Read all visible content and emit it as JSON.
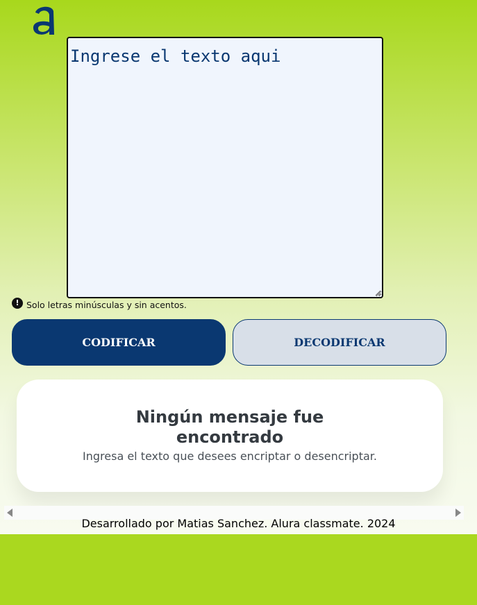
{
  "logo": {
    "icon": "alura-a-logo-icon",
    "color": "#0a3871"
  },
  "input": {
    "placeholder": "Ingrese el texto aqui",
    "value": ""
  },
  "hint": {
    "icon": "exclamation-circle-icon",
    "text": "Solo letras minúsculas y sin acentos."
  },
  "buttons": {
    "encode_label": "CODIFICAR",
    "decode_label": "DECODIFICAR"
  },
  "result": {
    "title_line1": "Ningún mensaje fue",
    "title_line2": "encontrado",
    "subtitle": "Ingresa el texto que desees encriptar o desencriptar."
  },
  "footer": {
    "text": "Desarrollado por Matias Sanchez. Alura classmate. 2024"
  },
  "colors": {
    "background_top": "#a8d81c",
    "background_bottom": "#f8fbf0",
    "primary": "#0a3871",
    "secondary_button": "#d8dfe8",
    "textarea_bg": "#f0f5fd"
  }
}
